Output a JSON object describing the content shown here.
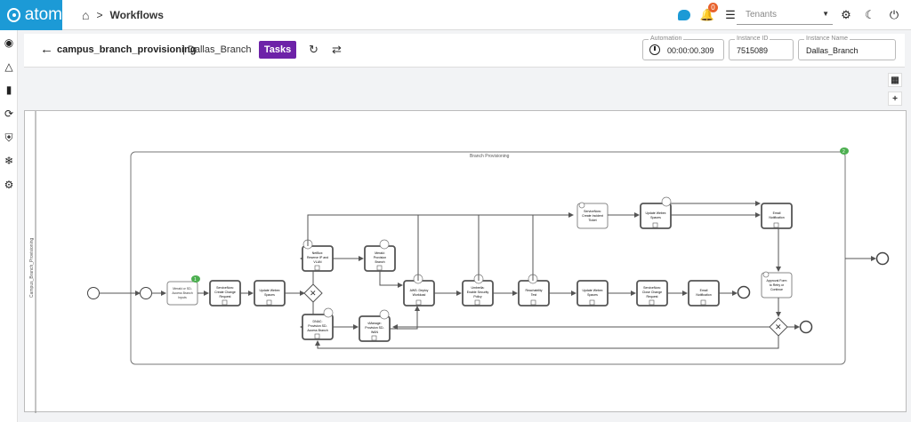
{
  "app": {
    "brand": "atom",
    "brand_color": "#1c9ad6"
  },
  "breadcrumb": {
    "home_icon": "home-icon",
    "separator": ">",
    "current": "Workflows"
  },
  "topbar": {
    "notification_count": "0",
    "tenant_placeholder": "Tenants"
  },
  "header": {
    "title": "campus_branch_provisioning",
    "subtitle": "| Dallas_Branch",
    "tasks_label": "Tasks",
    "tasks_color": "#6d22a8",
    "automation": {
      "label": "Automation",
      "value": "00:00:00.309"
    },
    "instance_id": {
      "label": "Instance ID",
      "value": "7515089"
    },
    "instance_name": {
      "label": "Instance Name",
      "value": "Dallas_Branch"
    }
  },
  "zoom_controls": [
    "+",
    "-",
    "F",
    "R"
  ],
  "diagram": {
    "pool_label": "Campus_Branch_Provisioning",
    "subprocess_label": "Branch Provisioning",
    "subprocess_badge": "2",
    "first_task_badge": "1",
    "tasks": {
      "t1": [
        "Meraki or SD-",
        "Access Branch",
        "Inputs"
      ],
      "t2": [
        "ServiceNow:",
        "Create Change",
        "Request"
      ],
      "t3": [
        "Update Webex",
        "Spaces"
      ],
      "t4": [
        "NetBox:",
        "Reserve IP and",
        "VLAN"
      ],
      "t5": [
        "DNAC:",
        "Provision SD-",
        "Access Branch"
      ],
      "t6": [
        "Meraki:",
        "Provision",
        "Branch"
      ],
      "t7": [
        "vManage:",
        "Provision SD-",
        "WAN"
      ],
      "t8": [
        "AWS: Deploy",
        "Workload"
      ],
      "t9": [
        "Umbrella:",
        "Enable Security",
        "Policy"
      ],
      "t10": [
        "Reachability",
        "Test"
      ],
      "t11": [
        "Update Webex",
        "Spaces"
      ],
      "t12": [
        "ServiceNow:",
        "Close Change",
        "Request"
      ],
      "t13": [
        "Email",
        "Notification"
      ],
      "t14": [
        "ServiceNow:",
        "Create Incident",
        "Ticket"
      ],
      "t15": [
        "Update Webex",
        "Spaces"
      ],
      "t16": [
        "Email",
        "Notification"
      ],
      "t17": [
        "Approval Form",
        "to Retry or",
        "Continue"
      ]
    }
  }
}
